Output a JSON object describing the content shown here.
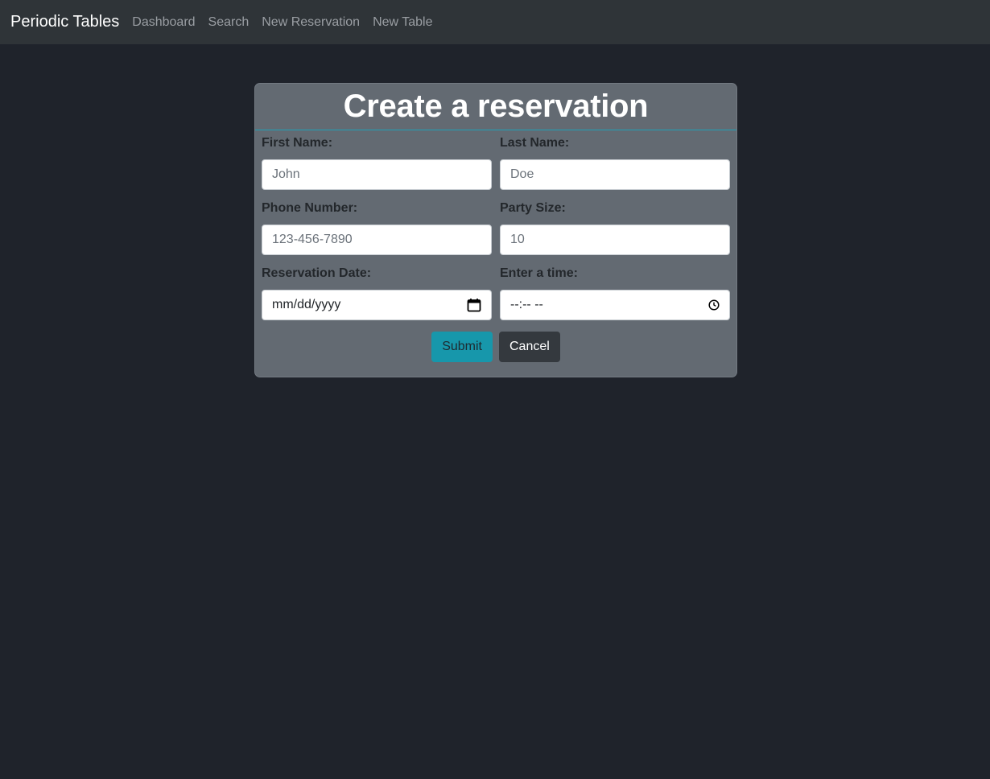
{
  "navbar": {
    "brand": "Periodic Tables",
    "links": [
      "Dashboard",
      "Search",
      "New Reservation",
      "New Table"
    ]
  },
  "form": {
    "title": "Create a reservation",
    "first_name": {
      "label": "First Name:",
      "placeholder": "John"
    },
    "last_name": {
      "label": "Last Name:",
      "placeholder": "Doe"
    },
    "phone": {
      "label": "Phone Number:",
      "placeholder": "123-456-7890"
    },
    "party_size": {
      "label": "Party Size:",
      "placeholder": "10"
    },
    "date": {
      "label": "Reservation Date:",
      "display": "mm/dd/yyyy",
      "icon": "calendar-icon"
    },
    "time": {
      "label": "Enter a time:",
      "display": "--:-- --",
      "icon": "clock-icon"
    },
    "submit_label": "Submit",
    "cancel_label": "Cancel"
  },
  "colors": {
    "background": "#1f232b",
    "navbar": "#2f3438",
    "card": "#636a72",
    "accent": "#1797ab",
    "cancel": "#34393e"
  }
}
